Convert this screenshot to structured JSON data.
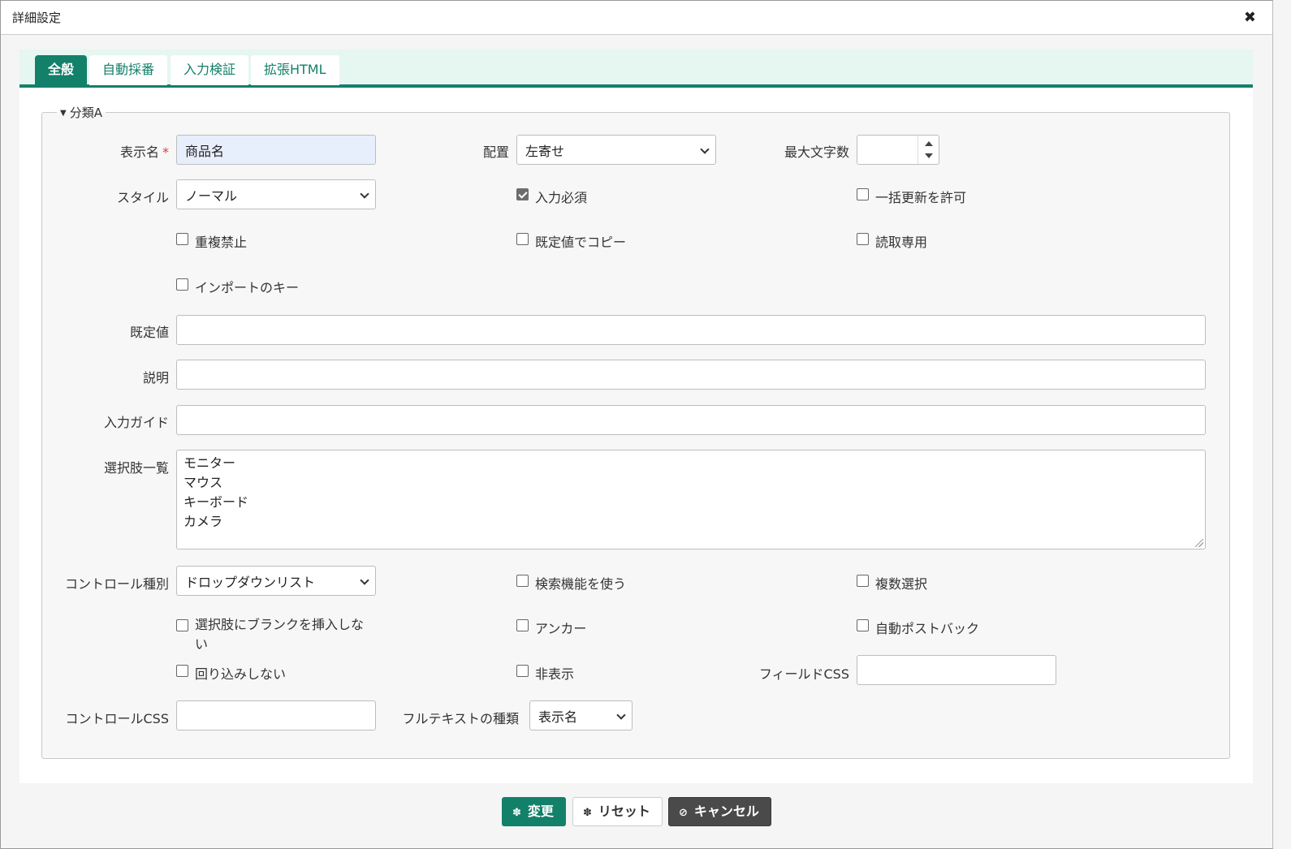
{
  "dialog": {
    "title": "詳細設定",
    "close_icon": "close-icon"
  },
  "tabs": [
    {
      "label": "全般",
      "active": true
    },
    {
      "label": "自動採番",
      "active": false
    },
    {
      "label": "入力検証",
      "active": false
    },
    {
      "label": "拡張HTML",
      "active": false
    }
  ],
  "section": {
    "legend": "分類A"
  },
  "fields": {
    "display_name": {
      "label": "表示名",
      "required_mark": "*",
      "value": "商品名"
    },
    "align": {
      "label": "配置",
      "value": "左寄せ"
    },
    "max_length": {
      "label": "最大文字数",
      "value": ""
    },
    "style": {
      "label": "スタイル",
      "value": "ノーマル"
    },
    "default_value": {
      "label": "既定値",
      "value": ""
    },
    "description": {
      "label": "説明",
      "value": ""
    },
    "input_guide": {
      "label": "入力ガイド",
      "value": ""
    },
    "choices": {
      "label": "選択肢一覧",
      "lines": [
        "モニター",
        "マウス",
        "キーボード",
        "カメラ"
      ]
    },
    "control_type": {
      "label": "コントロール種別",
      "value": "ドロップダウンリスト"
    },
    "field_css": {
      "label": "フィールドCSS",
      "value": ""
    },
    "control_css": {
      "label": "コントロールCSS",
      "value": ""
    },
    "fulltext_type": {
      "label": "フルテキストの種類",
      "value": "表示名"
    }
  },
  "checkboxes": {
    "required": {
      "label": "入力必須",
      "checked": true
    },
    "allow_bulk_update": {
      "label": "一括更新を許可",
      "checked": false
    },
    "no_duplicates": {
      "label": "重複禁止",
      "checked": false
    },
    "copy_by_default": {
      "label": "既定値でコピー",
      "checked": false
    },
    "read_only": {
      "label": "読取専用",
      "checked": false
    },
    "import_key": {
      "label": "インポートのキー",
      "checked": false
    },
    "use_search": {
      "label": "検索機能を使う",
      "checked": false
    },
    "multiple_select": {
      "label": "複数選択",
      "checked": false
    },
    "no_blank": {
      "label": "選択肢にブランクを挿入しない",
      "checked": false
    },
    "anchor": {
      "label": "アンカー",
      "checked": false
    },
    "auto_postback": {
      "label": "自動ポストバック",
      "checked": false
    },
    "no_wrap": {
      "label": "回り込みしない",
      "checked": false
    },
    "hidden": {
      "label": "非表示",
      "checked": false
    }
  },
  "buttons": {
    "change": "変更",
    "reset": "リセット",
    "cancel": "キャンセル"
  },
  "colors": {
    "accent": "#13806a",
    "tab_strip": "#e6f6f0",
    "required": "#e53935"
  }
}
